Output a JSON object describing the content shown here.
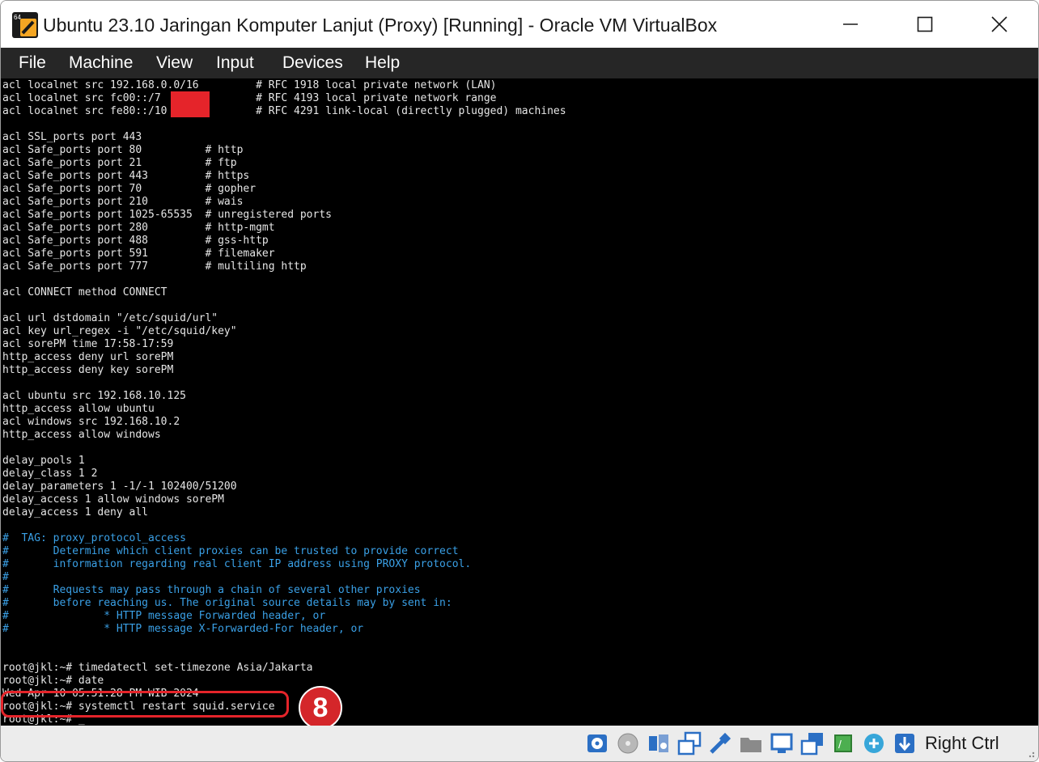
{
  "window": {
    "title": "Ubuntu 23.10 Jaringan Komputer Lanjut (Proxy) [Running] - Oracle VM VirtualBox",
    "icon_badge": "64",
    "controls": [
      "minimize-icon",
      "maximize-icon",
      "close-icon"
    ]
  },
  "menu": [
    "File",
    "Machine",
    "View",
    "Input",
    "Devices",
    "Help"
  ],
  "terminal": {
    "lines": [
      {
        "text": "acl localnet src 192.168.0.0/16         # RFC 1918 local private network (LAN)",
        "type": "normal"
      },
      {
        "text": "acl localnet src fc00::/7               # RFC 4193 local private network range",
        "type": "normal"
      },
      {
        "text": "acl localnet src fe80::/10              # RFC 4291 link-local (directly plugged) machines",
        "type": "normal"
      },
      {
        "text": "",
        "type": "normal"
      },
      {
        "text": "acl SSL_ports port 443",
        "type": "normal"
      },
      {
        "text": "acl Safe_ports port 80          # http",
        "type": "normal"
      },
      {
        "text": "acl Safe_ports port 21          # ftp",
        "type": "normal"
      },
      {
        "text": "acl Safe_ports port 443         # https",
        "type": "normal"
      },
      {
        "text": "acl Safe_ports port 70          # gopher",
        "type": "normal"
      },
      {
        "text": "acl Safe_ports port 210         # wais",
        "type": "normal"
      },
      {
        "text": "acl Safe_ports port 1025-65535  # unregistered ports",
        "type": "normal"
      },
      {
        "text": "acl Safe_ports port 280         # http-mgmt",
        "type": "normal"
      },
      {
        "text": "acl Safe_ports port 488         # gss-http",
        "type": "normal"
      },
      {
        "text": "acl Safe_ports port 591         # filemaker",
        "type": "normal"
      },
      {
        "text": "acl Safe_ports port 777         # multiling http",
        "type": "normal"
      },
      {
        "text": "",
        "type": "normal"
      },
      {
        "text": "acl CONNECT method CONNECT",
        "type": "normal"
      },
      {
        "text": "",
        "type": "normal"
      },
      {
        "text": "acl url dstdomain \"/etc/squid/url\"",
        "type": "normal"
      },
      {
        "text": "acl key url_regex -i \"/etc/squid/key\"",
        "type": "normal"
      },
      {
        "text": "acl sorePM time 17:58-17:59",
        "type": "normal"
      },
      {
        "text": "http_access deny url sorePM",
        "type": "normal"
      },
      {
        "text": "http_access deny key sorePM",
        "type": "normal"
      },
      {
        "text": "",
        "type": "normal"
      },
      {
        "text": "acl ubuntu src 192.168.10.125",
        "type": "normal"
      },
      {
        "text": "http_access allow ubuntu",
        "type": "normal"
      },
      {
        "text": "acl windows src 192.168.10.2",
        "type": "normal"
      },
      {
        "text": "http_access allow windows",
        "type": "normal"
      },
      {
        "text": "",
        "type": "normal"
      },
      {
        "text": "delay_pools 1",
        "type": "normal"
      },
      {
        "text": "delay_class 1 2",
        "type": "normal"
      },
      {
        "text": "delay_parameters 1 -1/-1 102400/51200",
        "type": "normal"
      },
      {
        "text": "delay_access 1 allow windows sorePM",
        "type": "normal"
      },
      {
        "text": "delay_access 1 deny all",
        "type": "normal"
      },
      {
        "text": "",
        "type": "normal"
      },
      {
        "text": "#  TAG: proxy_protocol_access",
        "type": "comment"
      },
      {
        "text": "#       Determine which client proxies can be trusted to provide correct",
        "type": "comment"
      },
      {
        "text": "#       information regarding real client IP address using PROXY protocol.",
        "type": "comment"
      },
      {
        "text": "#",
        "type": "comment"
      },
      {
        "text": "#       Requests may pass through a chain of several other proxies",
        "type": "comment"
      },
      {
        "text": "#       before reaching us. The original source details may by sent in:",
        "type": "comment"
      },
      {
        "text": "#               * HTTP message Forwarded header, or",
        "type": "comment"
      },
      {
        "text": "#               * HTTP message X-Forwarded-For header, or",
        "type": "comment"
      },
      {
        "text": "",
        "type": "normal"
      },
      {
        "text": "",
        "type": "normal"
      },
      {
        "text": "root@jkl:~# timedatectl set-timezone Asia/Jakarta",
        "type": "normal"
      },
      {
        "text": "root@jkl:~# date",
        "type": "normal"
      },
      {
        "text": "Wed Apr 10 05:51:28 PM WIB 2024",
        "type": "normal"
      },
      {
        "text": "root@jkl:~# systemctl restart squid.service",
        "type": "normal"
      },
      {
        "text": "root@jkl:~# _",
        "type": "normal"
      }
    ]
  },
  "annotation": {
    "step": "8"
  },
  "statusbar": {
    "icons": [
      "hard-disk-icon",
      "optical-drive-icon",
      "audio-icon",
      "network-icon",
      "usb-icon",
      "shared-folders-icon",
      "display-icon",
      "recording-icon",
      "cpu-icon",
      "mouse-integration-icon",
      "keyboard-icon"
    ],
    "host_key": "Right Ctrl"
  },
  "colors": {
    "menubar": "#262626",
    "terminal_bg": "#000000",
    "terminal_fg": "#e6e6e6",
    "comment": "#3aa0e6",
    "highlight": "#e5242a"
  }
}
